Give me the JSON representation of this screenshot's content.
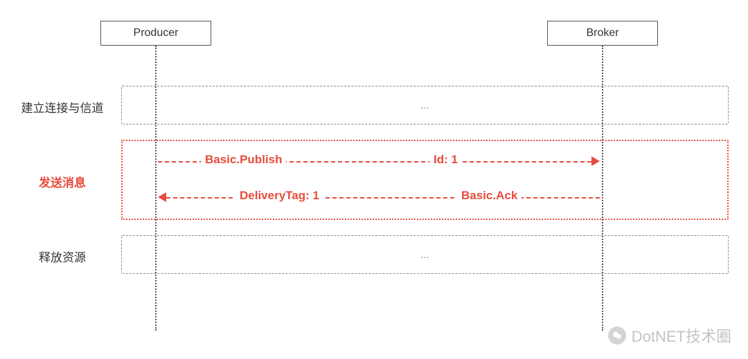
{
  "participants": {
    "producer": "Producer",
    "broker": "Broker"
  },
  "phases": {
    "connect": {
      "label": "建立连接与信道",
      "content": "..."
    },
    "send": {
      "label": "发送消息",
      "messages": {
        "publish": {
          "text": "Basic.Publish",
          "id_label": "Id: 1"
        },
        "ack": {
          "text": "Basic.Ack",
          "tag_label": "DeliveryTag: 1"
        }
      }
    },
    "release": {
      "label": "释放资源",
      "content": "..."
    }
  },
  "watermark": "DotNET技术圈",
  "colors": {
    "accent": "#e74c3c",
    "line": "#555555",
    "muted": "#888888"
  }
}
